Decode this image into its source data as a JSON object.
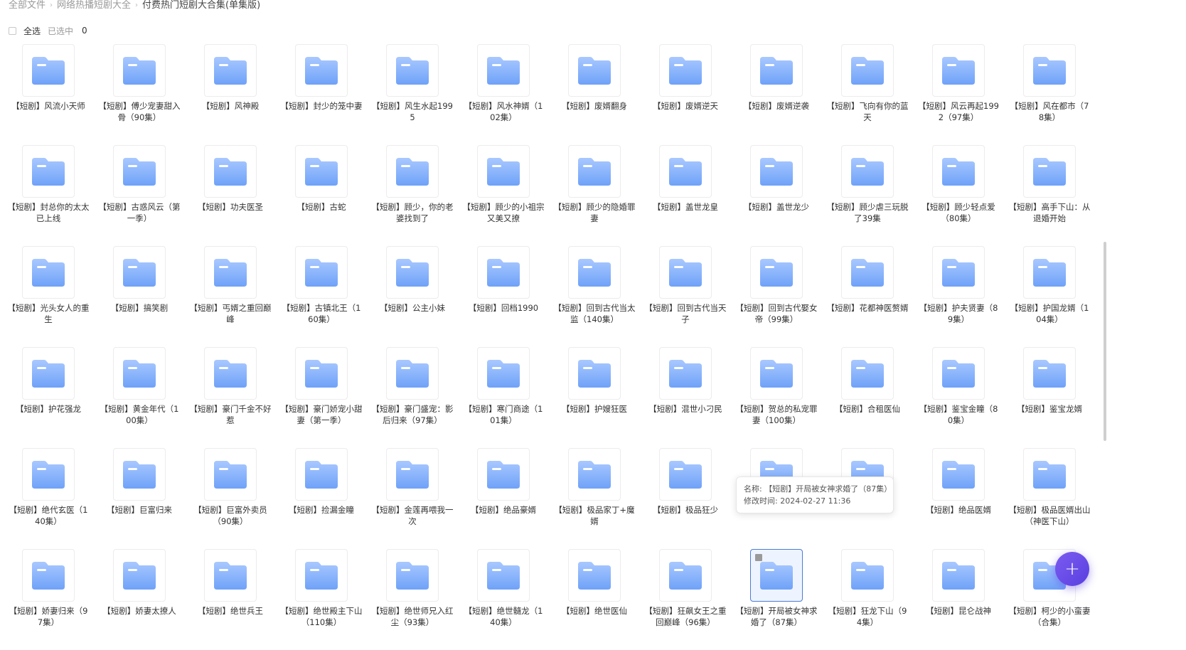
{
  "breadcrumb": {
    "items": [
      "全部文件",
      "网络热播短剧大全",
      "付费热门短剧大合集(单集版)"
    ]
  },
  "toolbar": {
    "select_all": "全选",
    "selected_label": "已选中",
    "selected_count": "0"
  },
  "files": [
    "【短剧】风流小天师",
    "【短剧】傅少宠妻甜入骨（90集）",
    "【短剧】风神殿",
    "【短剧】封少的笼中妻",
    "【短剧】风生水起1995",
    "【短剧】风水神婿（102集）",
    "【短剧】废婿翻身",
    "【短剧】废婿逆天",
    "【短剧】废婿逆袭",
    "【短剧】飞向有你的蓝天",
    "【短剧】风云再起1992（97集）",
    "【短剧】风在都市（78集）",
    "【短剧】封总你的太太已上线",
    "【短剧】古惑风云（第一季）",
    "【短剧】功夫医圣",
    "【短剧】古蛇",
    "【短剧】顾少，你的老婆找到了",
    "【短剧】顾少的小祖宗又美又撩",
    "【短剧】顾少的隐婚罪妻",
    "【短剧】盖世龙皇",
    "【短剧】盖世龙少",
    "【短剧】顾少虐三玩脱了39集",
    "【短剧】顾少轻点爱（80集）",
    "【短剧】高手下山：从退婚开始",
    "【短剧】光头女人的重生",
    "【短剧】搞笑剧",
    "【短剧】丐婿之重回巅峰",
    "【短剧】古镇北王（160集）",
    "【短剧】公主小妹",
    "【短剧】回档1990",
    "【短剧】回到古代当太监（140集）",
    "【短剧】回到古代当天子",
    "【短剧】回到古代娶女帝（99集）",
    "【短剧】花都神医赘婿",
    "【短剧】护夫贤妻（89集）",
    "【短剧】护国龙婿（104集）",
    "【短剧】护花强龙",
    "【短剧】黄金年代（100集）",
    "【短剧】豪门千金不好惹",
    "【短剧】豪门娇宠小甜妻（第一季）",
    "【短剧】豪门盛宠：影后归来（97集）",
    "【短剧】寒门商途（101集）",
    "【短剧】护嫂狂医",
    "【短剧】混世小刁民",
    "【短剧】贺总的私宠罪妻（100集）",
    "【短剧】合租医仙",
    "【短剧】鉴宝金瞳（80集）",
    "【短剧】鉴宝龙婿",
    "【短剧】绝代玄医（140集）",
    "【短剧】巨富归来",
    "【短剧】巨富外卖员（90集）",
    "【短剧】捡漏金瞳",
    "【短剧】金莲再喂我一次",
    "【短剧】绝品豪婿",
    "【短剧】极品家丁+魔婿",
    "【短剧】极品狂少",
    "",
    "",
    "【短剧】绝品医婿",
    "【短剧】极品医婿出山（神医下山）",
    "【短剧】娇妻归来（97集）",
    "【短剧】娇妻太撩人",
    "【短剧】绝世兵王",
    "【短剧】绝世殿主下山（110集）",
    "【短剧】绝世师兄入红尘（93集）",
    "【短剧】绝世髓龙（140集）",
    "【短剧】绝世医仙",
    "【短剧】狂飙女王之重回巅峰（96集）",
    "【短剧】开局被女神求婚了（87集）",
    "【短剧】狂龙下山（94集）",
    "【短剧】昆仑战神",
    "【短剧】柯少的小蛮妻（合集）"
  ],
  "tooltip": {
    "name_line": "名称: 【短剧】开局被女神求婚了（87集）",
    "time_line": "修改时间: 2024-02-27 11:36"
  },
  "hovered_index": 68,
  "fab": {
    "label": "+"
  },
  "colors": {
    "folder_light": "#a9c8ff",
    "folder_dark": "#6fa2f8",
    "accent": "#5a3fe0"
  }
}
